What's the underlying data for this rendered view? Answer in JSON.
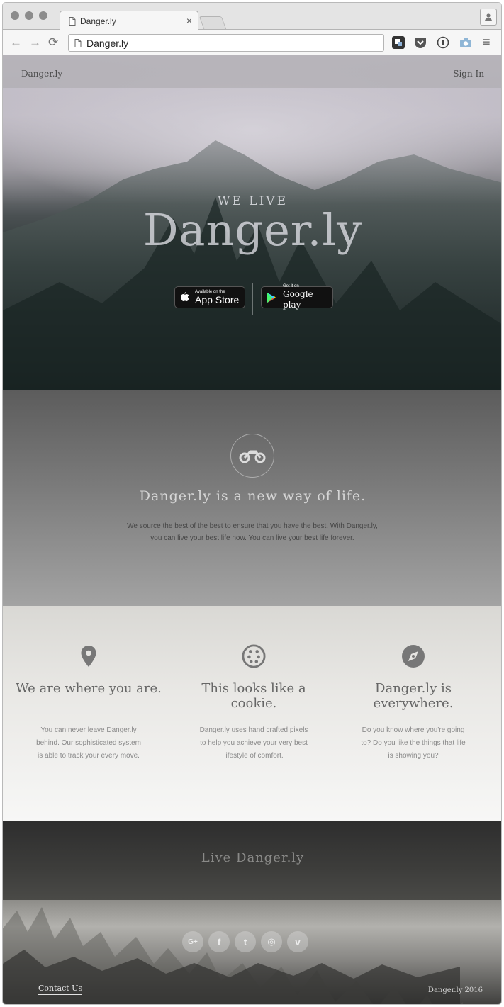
{
  "browser": {
    "tab_title": "Danger.ly",
    "close_glyph": "×",
    "address": "Danger.ly",
    "back_glyph": "←",
    "forward_glyph": "→",
    "reload_glyph": "⟳",
    "menu_glyph": "≡"
  },
  "nav": {
    "brand": "Danger.ly",
    "sign_in": "Sign In"
  },
  "hero": {
    "kicker": "WE LIVE",
    "title": "Danger.ly",
    "app_store": {
      "small": "Available on the",
      "big": "App Store"
    },
    "google_play": {
      "small": "Get it on",
      "big": "Google play"
    }
  },
  "intro": {
    "icon": "motorcycle-icon",
    "heading": "Danger.ly is a new way of life.",
    "body": "We source the best of the best to ensure that you have the best. With Danger.ly, you can live your best life now. You can live your best life forever."
  },
  "features": [
    {
      "icon": "map-pin-icon",
      "title": "We are where you are.",
      "body": "You can never leave Danger.ly behind. Our sophisticated system is able to track your every move."
    },
    {
      "icon": "cookie-icon",
      "title": "This looks like a cookie.",
      "body": "Danger.ly uses hand crafted pixels to help you achieve your very best lifestyle of comfort."
    },
    {
      "icon": "compass-icon",
      "title": "Danger.ly is everywhere.",
      "body": "Do you know where you're going to? Do you like the things that life is showing you?"
    }
  ],
  "cta": {
    "text": "Live Danger.ly"
  },
  "footer": {
    "social": [
      "google-plus-icon",
      "facebook-icon",
      "twitter-icon",
      "instagram-icon",
      "vimeo-icon"
    ],
    "social_glyphs": [
      "G+",
      "f",
      "t",
      "◎",
      "v"
    ],
    "contact": "Contact Us",
    "copyright": "Danger.ly 2016"
  },
  "colors": {
    "hero_dark": "#141c1d",
    "fog": "#b7b2bc",
    "intro_gray": "#7b7b7b",
    "feature_bg": "#e9e8e5",
    "cta_bg": "#3d3d3b"
  }
}
